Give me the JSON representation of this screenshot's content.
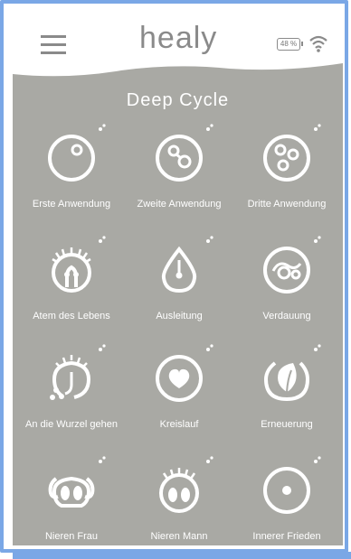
{
  "header": {
    "logo": "healy",
    "battery": "48 %"
  },
  "program": {
    "title": "Deep Cycle"
  },
  "tiles": [
    {
      "label": "Erste Anwendung",
      "icon": "circle-one-dot-icon"
    },
    {
      "label": "Zweite Anwendung",
      "icon": "circle-two-dots-icon"
    },
    {
      "label": "Dritte Anwendung",
      "icon": "circle-three-dots-icon"
    },
    {
      "label": "Atem des Lebens",
      "icon": "lungs-icon"
    },
    {
      "label": "Ausleitung",
      "icon": "drop-icon"
    },
    {
      "label": "Verdauung",
      "icon": "digestion-icon"
    },
    {
      "label": "An die Wurzel gehen",
      "icon": "root-icon"
    },
    {
      "label": "Kreislauf",
      "icon": "heart-icon"
    },
    {
      "label": "Erneuerung",
      "icon": "leaf-icon"
    },
    {
      "label": "Nieren Frau",
      "icon": "kidneys-female-icon"
    },
    {
      "label": "Nieren Mann",
      "icon": "kidneys-male-icon"
    },
    {
      "label": "Innerer Frieden",
      "icon": "inner-peace-icon"
    }
  ],
  "colors": {
    "screen_bg": "#a9a9a4",
    "accent_border": "#7aa7e6",
    "icon": "#ffffff",
    "header_gray": "#8a8a8a"
  }
}
